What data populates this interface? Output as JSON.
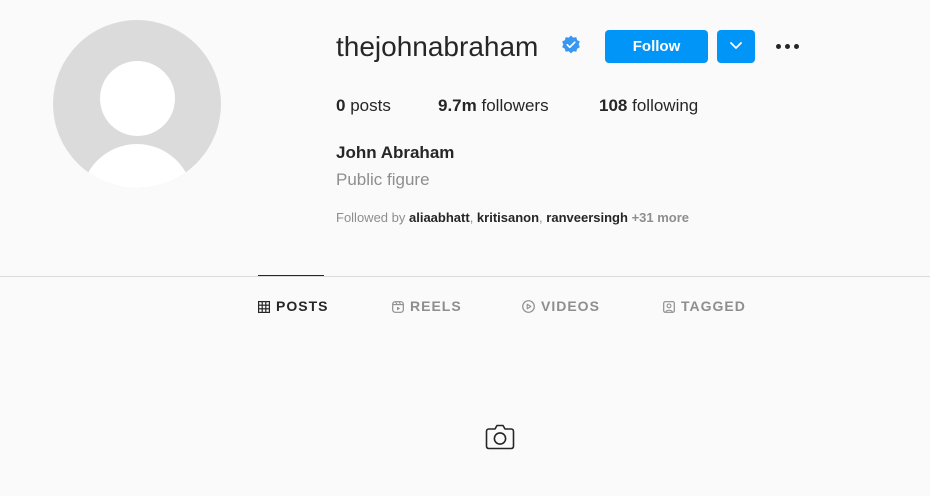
{
  "profile": {
    "username": "thejohnabraham",
    "verified": true,
    "full_name": "John Abraham",
    "category": "Public figure"
  },
  "actions": {
    "follow_label": "Follow"
  },
  "stats": {
    "posts_count": "0",
    "posts_label": "posts",
    "followers_count": "9.7m",
    "followers_label": "followers",
    "following_count": "108",
    "following_label": "following"
  },
  "followed_by": {
    "prefix": "Followed by",
    "names": [
      "aliaabhatt",
      "kritisanon",
      "ranveersingh"
    ],
    "more": "+31 more"
  },
  "tabs": [
    {
      "label": "POSTS",
      "icon": "grid-icon",
      "active": true
    },
    {
      "label": "REELS",
      "icon": "reels-icon",
      "active": false
    },
    {
      "label": "VIDEOS",
      "icon": "play-circle-icon",
      "active": false
    },
    {
      "label": "TAGGED",
      "icon": "tagged-icon",
      "active": false
    }
  ],
  "empty_state": {
    "icon": "camera-icon"
  },
  "colors": {
    "accent": "#0095f6",
    "background": "#fafafa",
    "text": "#262626",
    "muted": "#8e8e8e"
  }
}
